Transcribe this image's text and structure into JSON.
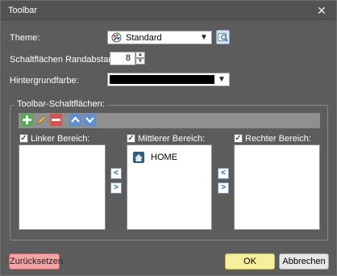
{
  "window": {
    "title": "Toolbar",
    "close_glyph": "✕"
  },
  "theme": {
    "label": "Theme:",
    "value": "Standard",
    "icon": "palette-icon",
    "browse_icon": "browse-icon"
  },
  "spacing": {
    "label": "Schaltflächen Randabstand:",
    "value": "8"
  },
  "background": {
    "label": "Hintergrundfarbe:",
    "color": "#000000"
  },
  "group": {
    "title": "Toolbar-Schaltflächen:",
    "toolbar": [
      {
        "name": "add-icon",
        "color": "#4caf50",
        "glyph": "+"
      },
      {
        "name": "edit-icon",
        "color": "#f3c23b",
        "glyph": "✎"
      },
      {
        "name": "remove-icon",
        "color": "#d9534f",
        "glyph": "−"
      },
      {
        "name": "move-up-icon",
        "color": "#5b8fd6",
        "glyph": "▲"
      },
      {
        "name": "move-down-icon",
        "color": "#5b8fd6",
        "glyph": "▼"
      }
    ]
  },
  "panels": {
    "left": {
      "label": "Linker Bereich:",
      "checked": true,
      "items": []
    },
    "middle": {
      "label": "Mittlerer Bereich:",
      "checked": true,
      "items": [
        {
          "label": "HOME",
          "icon": "home-icon"
        }
      ]
    },
    "right": {
      "label": "Rechter Bereich:",
      "checked": true,
      "items": []
    }
  },
  "buttons": {
    "reset": "Zurücksetzen",
    "ok": "OK",
    "cancel": "Abbrechen"
  }
}
